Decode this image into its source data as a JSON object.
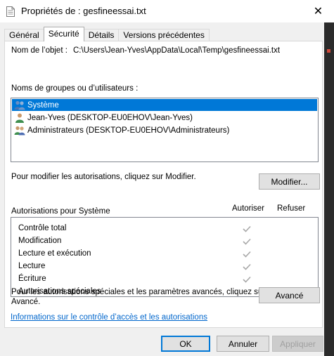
{
  "window": {
    "title": "Propriétés de : gesfineessai.txt",
    "close_glyph": "✕"
  },
  "tabs": [
    {
      "label": "Général"
    },
    {
      "label": "Sécurité"
    },
    {
      "label": "Détails"
    },
    {
      "label": "Versions précédentes"
    }
  ],
  "security": {
    "object_label": "Nom de l’objet :",
    "object_value": "C:\\Users\\Jean-Yves\\AppData\\Local\\Temp\\gesfineessai.txt",
    "groups_label": "Noms de groupes ou d’utilisateurs :",
    "groups": [
      {
        "name": "Système",
        "icon": "group-users-icon",
        "selected": true
      },
      {
        "name": "Jean-Yves (DESKTOP-EU0EHOV\\Jean-Yves)",
        "icon": "user-icon",
        "selected": false
      },
      {
        "name": "Administrateurs (DESKTOP-EU0EHOV\\Administrateurs)",
        "icon": "group-users-icon",
        "selected": false
      }
    ],
    "modify_hint": "Pour modifier les autorisations, cliquez sur Modifier.",
    "modify_button": "Modifier...",
    "permissions_label": "Autorisations pour Système",
    "allow_header": "Autoriser",
    "deny_header": "Refuser",
    "permissions": [
      {
        "name": "Contrôle total",
        "allow": true,
        "deny": false
      },
      {
        "name": "Modification",
        "allow": true,
        "deny": false
      },
      {
        "name": "Lecture et exécution",
        "allow": true,
        "deny": false
      },
      {
        "name": "Lecture",
        "allow": true,
        "deny": false
      },
      {
        "name": "Écriture",
        "allow": true,
        "deny": false
      },
      {
        "name": "Autorisations spéciales",
        "allow": false,
        "deny": false
      }
    ],
    "advanced_hint_line1": "Pour les autorisations spéciales et les paramètres avancés, cliquez sur",
    "advanced_hint_line2": "Avancé.",
    "advanced_button": "Avancé",
    "info_link": "Informations sur le contrôle d’accès et les autorisations"
  },
  "footer": {
    "ok": "OK",
    "cancel": "Annuler",
    "apply": "Appliquer"
  },
  "colors": {
    "selection": "#0078d7",
    "link": "#0066cc",
    "check_gray": "#a8a8a8"
  }
}
